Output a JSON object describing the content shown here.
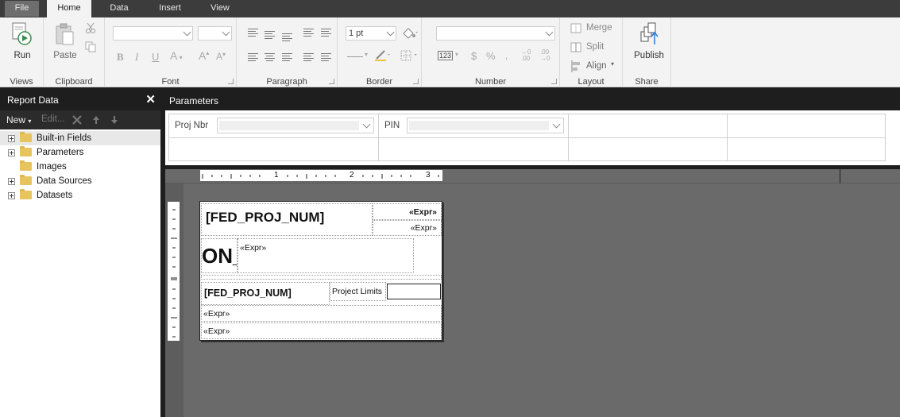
{
  "tabs": {
    "file": "File",
    "home": "Home",
    "data": "Data",
    "insert": "Insert",
    "view": "View"
  },
  "ribbon": {
    "views": {
      "run": "Run",
      "label": "Views"
    },
    "clipboard": {
      "paste": "Paste",
      "label": "Clipboard"
    },
    "font": {
      "label": "Font"
    },
    "paragraph": {
      "label": "Paragraph"
    },
    "border": {
      "weight": "1 pt",
      "label": "Border"
    },
    "number": {
      "label": "Number"
    },
    "layout": {
      "merge": "Merge",
      "split": "Split",
      "align": "Align",
      "label": "Layout"
    },
    "share": {
      "publish": "Publish",
      "label": "Share"
    }
  },
  "report_data": {
    "title": "Report Data",
    "toolbar": {
      "new": "New",
      "edit": "Edit..."
    },
    "items": [
      {
        "label": "Built-in Fields",
        "expandable": true,
        "selected": true
      },
      {
        "label": "Parameters",
        "expandable": true,
        "selected": false
      },
      {
        "label": "Images",
        "expandable": false,
        "selected": false
      },
      {
        "label": "Data Sources",
        "expandable": true,
        "selected": false
      },
      {
        "label": "Datasets",
        "expandable": true,
        "selected": false
      }
    ]
  },
  "parameters": {
    "title": "Parameters",
    "proj_nbr": "Proj Nbr",
    "pin": "PIN"
  },
  "ruler": {
    "marks": [
      "1",
      "2",
      "3"
    ]
  },
  "report": {
    "title_field": "[FED_PROJ_NUM]",
    "expr_bold": "«Expr»",
    "expr": "«Expr»",
    "big_text": "ON_",
    "box_expr": "«Expr»",
    "fed_proj_num": "[FED_PROJ_NUM]",
    "project_limits": "Project Limits",
    "row_expr_1": "«Expr»",
    "row_expr_2": "«Expr»"
  }
}
